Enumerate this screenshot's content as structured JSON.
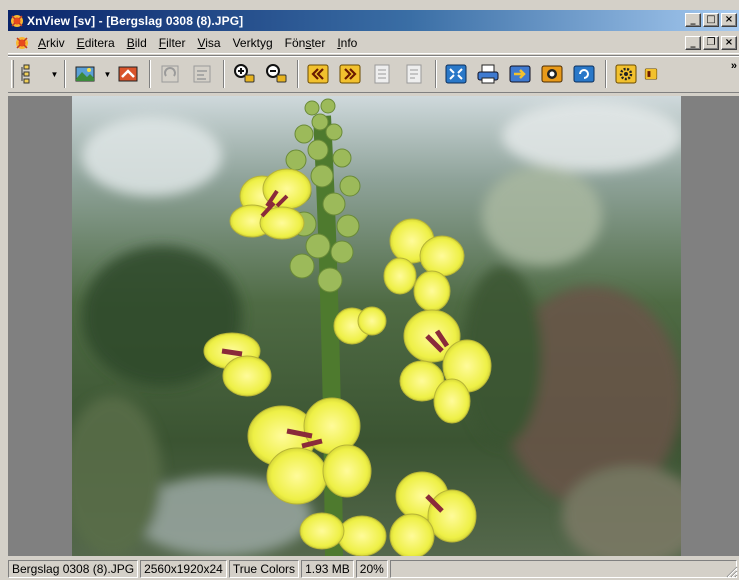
{
  "window": {
    "title": "XnView [sv] - [Bergslag 0308 (8).JPG]",
    "buttons": {
      "minimize": "_",
      "maximize": "□",
      "close": "×"
    }
  },
  "menu": {
    "items": [
      {
        "label": "Arkiv",
        "underline": "A",
        "rest": "rkiv"
      },
      {
        "label": "Editera",
        "underline": "E",
        "rest": "ditera"
      },
      {
        "label": "Bild",
        "underline": "B",
        "rest": "ild"
      },
      {
        "label": "Filter",
        "underline": "F",
        "rest": "ilter"
      },
      {
        "label": "Visa",
        "underline": "V",
        "rest": "isa"
      },
      {
        "label": "Verktyg",
        "underline": "",
        "rest": "Verktyg"
      },
      {
        "label": "Fönster",
        "pre": "Fön",
        "underline": "s",
        "rest": "ter"
      },
      {
        "label": "Info",
        "underline": "I",
        "rest": "nfo"
      }
    ],
    "mdi_buttons": {
      "minimize": "_",
      "restore": "❐",
      "close": "×"
    }
  },
  "toolbar": {
    "overflow": "»",
    "dropdown_arrow": "▼"
  },
  "status": {
    "filename": "Bergslag 0308 (8).JPG",
    "dimensions": "2560x1920x24",
    "colors": "True Colors",
    "filesize": "1.93 MB",
    "zoom": "20%"
  },
  "colors": {
    "titlebar_start": "#0a246a",
    "titlebar_end": "#a6caf0",
    "face": "#d4d0c8",
    "view_bg": "#808080"
  }
}
